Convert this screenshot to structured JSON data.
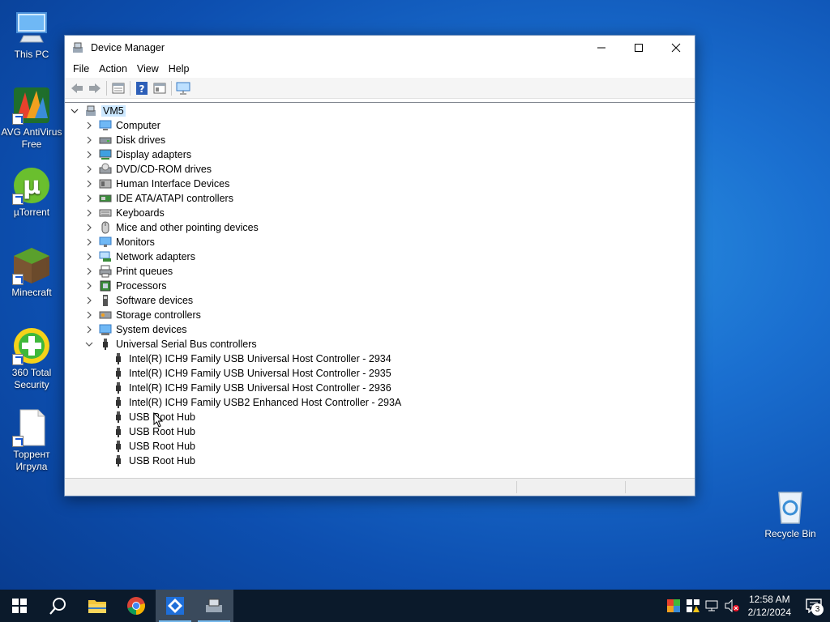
{
  "desktop": {
    "icons": [
      {
        "label": "This PC"
      },
      {
        "label": "AVG AntiVirus Free"
      },
      {
        "label": "µTorrent"
      },
      {
        "label": "Minecraft"
      },
      {
        "label": "360 Total Security"
      },
      {
        "label": "Торрент Игрула"
      },
      {
        "label": "Recycle Bin"
      }
    ]
  },
  "window": {
    "title": "Device Manager",
    "menu": [
      "File",
      "Action",
      "View",
      "Help"
    ],
    "toolbar_icons": [
      "back-arrow-icon",
      "forward-arrow-icon",
      "properties-icon",
      "help-icon",
      "view-icon",
      "monitor-icon"
    ],
    "tree": {
      "root": "VM5",
      "categories": [
        {
          "label": "Computer",
          "icon": "computer-icon"
        },
        {
          "label": "Disk drives",
          "icon": "disk-drive-icon"
        },
        {
          "label": "Display adapters",
          "icon": "display-adapter-icon"
        },
        {
          "label": "DVD/CD-ROM drives",
          "icon": "dvd-drive-icon"
        },
        {
          "label": "Human Interface Devices",
          "icon": "hid-icon"
        },
        {
          "label": "IDE ATA/ATAPI controllers",
          "icon": "ide-controller-icon"
        },
        {
          "label": "Keyboards",
          "icon": "keyboard-icon"
        },
        {
          "label": "Mice and other pointing devices",
          "icon": "mouse-icon"
        },
        {
          "label": "Monitors",
          "icon": "monitor-icon"
        },
        {
          "label": "Network adapters",
          "icon": "network-adapter-icon"
        },
        {
          "label": "Print queues",
          "icon": "printer-icon"
        },
        {
          "label": "Processors",
          "icon": "processor-icon"
        },
        {
          "label": "Software devices",
          "icon": "software-device-icon"
        },
        {
          "label": "Storage controllers",
          "icon": "storage-controller-icon"
        },
        {
          "label": "System devices",
          "icon": "system-device-icon"
        },
        {
          "label": "Universal Serial Bus controllers",
          "icon": "usb-icon"
        }
      ],
      "usb_children": [
        "Intel(R) ICH9 Family USB Universal Host Controller - 2934",
        "Intel(R) ICH9 Family USB Universal Host Controller - 2935",
        "Intel(R) ICH9 Family USB Universal Host Controller - 2936",
        "Intel(R) ICH9 Family USB2 Enhanced Host Controller - 293A",
        "USB Root Hub",
        "USB Root Hub",
        "USB Root Hub",
        "USB Root Hub"
      ]
    }
  },
  "taskbar": {
    "apps": [
      "start-icon",
      "search-icon",
      "file-explorer-icon",
      "chrome-icon",
      "app-icon",
      "device-manager-icon"
    ],
    "clock_time": "12:58 AM",
    "clock_date": "2/12/2024",
    "notification_count": "3"
  }
}
